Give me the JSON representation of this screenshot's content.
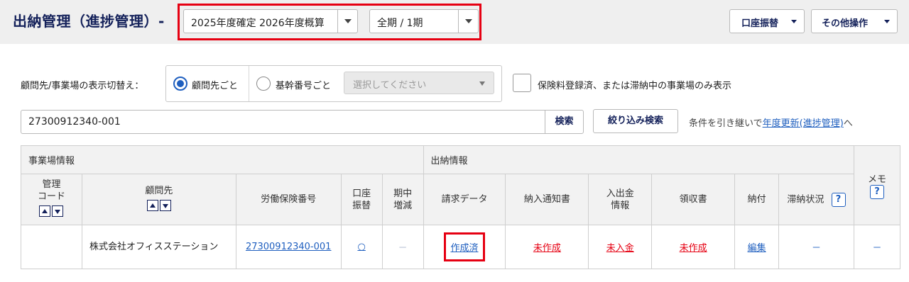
{
  "header": {
    "title": "出納管理（進捗管理）-",
    "year_select": "2025年度確定 2026年度概算",
    "period_select": "全期 / 1期",
    "transfer_button": "口座振替",
    "other_ops_button": "その他操作",
    "highlight_color": "#e60012"
  },
  "filter": {
    "display_label": "顧問先/事業場の表示切替え：",
    "radio_client": "顧問先ごと",
    "radio_basic": "基幹番号ごと",
    "select_placeholder": "選択してください",
    "checkbox_label": "保険料登録済、または滞納中の事業場のみ表示"
  },
  "search": {
    "value": "27300912340-001",
    "search_button": "検索",
    "narrow_button": "絞り込み検索",
    "hint_prefix": "条件を引き継いで",
    "hint_link": "年度更新(進捗管理)",
    "hint_suffix": "へ"
  },
  "table": {
    "group_office": "事業場情報",
    "group_cash": "出納情報",
    "col_code_1": "管理",
    "col_code_2": "コード",
    "col_client": "顧問先",
    "col_insurance_no": "労働保険番号",
    "col_transfer_1": "口座",
    "col_transfer_2": "振替",
    "col_change_1": "期中",
    "col_change_2": "増減",
    "col_invoice": "請求データ",
    "col_notice": "納入通知書",
    "col_inout_1": "入出金",
    "col_inout_2": "情報",
    "col_receipt": "領収書",
    "col_payment": "納付",
    "col_delinquent": "滞納状況",
    "col_memo": "メモ",
    "help_glyph": "?",
    "row": {
      "code": "",
      "client": "株式会社オフィスステーション",
      "insurance_no": "27300912340-001",
      "transfer": "○",
      "change": "－",
      "invoice": "作成済",
      "notice": "未作成",
      "inout": "未入金",
      "receipt": "未作成",
      "payment": "編集",
      "delinquent": "－",
      "memo": "－"
    }
  }
}
